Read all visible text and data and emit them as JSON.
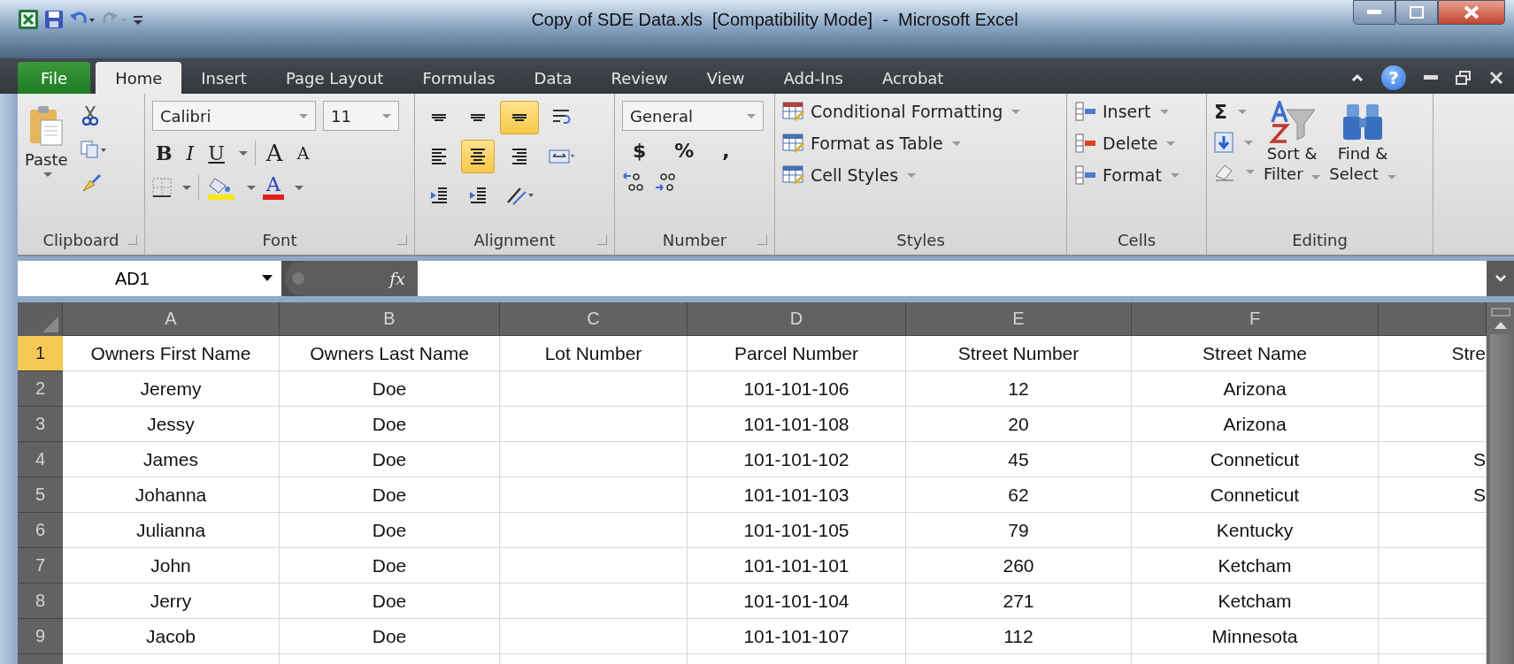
{
  "window": {
    "title": "Copy of SDE Data.xls  [Compatibility Mode]  -  Microsoft Excel"
  },
  "tabs": [
    {
      "label": "File",
      "kind": "file",
      "selected": false
    },
    {
      "label": "Home",
      "kind": "tab",
      "selected": true
    },
    {
      "label": "Insert",
      "kind": "tab",
      "selected": false
    },
    {
      "label": "Page Layout",
      "kind": "tab",
      "selected": false
    },
    {
      "label": "Formulas",
      "kind": "tab",
      "selected": false
    },
    {
      "label": "Data",
      "kind": "tab",
      "selected": false
    },
    {
      "label": "Review",
      "kind": "tab",
      "selected": false
    },
    {
      "label": "View",
      "kind": "tab",
      "selected": false
    },
    {
      "label": "Add-Ins",
      "kind": "tab",
      "selected": false
    },
    {
      "label": "Acrobat",
      "kind": "tab",
      "selected": false
    }
  ],
  "help": "?",
  "clipboard": {
    "label": "Clipboard",
    "paste": "Paste"
  },
  "font": {
    "label": "Font",
    "name": "Calibri",
    "size": "11",
    "styles": [
      "B",
      "I",
      "U"
    ],
    "grow": "A",
    "shrink": "A",
    "color_letter": "A"
  },
  "alignment": {
    "label": "Alignment",
    "buttons": [
      {
        "kind": "top",
        "selected": false
      },
      {
        "kind": "middle",
        "selected": false
      },
      {
        "kind": "bottom",
        "selected": true
      },
      {
        "kind": "wrap",
        "selected": false
      },
      {
        "kind": "left",
        "selected": false
      },
      {
        "kind": "center",
        "selected": true
      },
      {
        "kind": "right",
        "selected": false
      },
      {
        "kind": "merge",
        "selected": false
      },
      {
        "kind": "outdent",
        "selected": false
      },
      {
        "kind": "indent",
        "selected": false
      },
      {
        "kind": "orientation",
        "selected": false
      }
    ]
  },
  "number": {
    "label": "Number",
    "format": "General",
    "symbols": [
      "$",
      "%",
      ","
    ]
  },
  "styles": {
    "label": "Styles",
    "items": [
      "Conditional Formatting",
      "Format as Table",
      "Cell Styles"
    ]
  },
  "cells": {
    "label": "Cells",
    "items": [
      "Insert",
      "Delete",
      "Format"
    ]
  },
  "editing": {
    "label": "Editing",
    "sum": "Σ",
    "sort": [
      "Sort &",
      "Filter"
    ],
    "find": [
      "Find &",
      "Select"
    ]
  },
  "formula_bar": {
    "name_box": "AD1",
    "fx": "fx"
  },
  "sheet": {
    "columns": [
      "A",
      "B",
      "C",
      "D",
      "E",
      "F"
    ],
    "rows": [
      {
        "number": "1",
        "selected": true,
        "cells": [
          "Owners First Name",
          "Owners Last Name",
          "Lot Number",
          "Parcel Number",
          "Street Number",
          "Street Name",
          "Stre"
        ]
      },
      {
        "number": "2",
        "selected": false,
        "cells": [
          "Jeremy",
          "Doe",
          null,
          "101-101-106",
          "12",
          "Arizona",
          null
        ]
      },
      {
        "number": "3",
        "selected": false,
        "cells": [
          "Jessy",
          "Doe",
          null,
          "101-101-108",
          "20",
          "Arizona",
          null
        ]
      },
      {
        "number": "4",
        "selected": false,
        "cells": [
          "James",
          "Doe",
          null,
          "101-101-102",
          "45",
          "Conneticut",
          "S"
        ]
      },
      {
        "number": "5",
        "selected": false,
        "cells": [
          "Johanna",
          "Doe",
          null,
          "101-101-103",
          "62",
          "Conneticut",
          "S"
        ]
      },
      {
        "number": "6",
        "selected": false,
        "cells": [
          "Julianna",
          "Doe",
          null,
          "101-101-105",
          "79",
          "Kentucky",
          null
        ]
      },
      {
        "number": "7",
        "selected": false,
        "cells": [
          "John",
          "Doe",
          null,
          "101-101-101",
          "260",
          "Ketcham",
          null
        ]
      },
      {
        "number": "8",
        "selected": false,
        "cells": [
          "Jerry",
          "Doe",
          null,
          "101-101-104",
          "271",
          "Ketcham",
          null
        ]
      },
      {
        "number": "9",
        "selected": false,
        "cells": [
          "Jacob",
          "Doe",
          null,
          "101-101-107",
          "112",
          "Minnesota",
          null
        ]
      }
    ]
  }
}
